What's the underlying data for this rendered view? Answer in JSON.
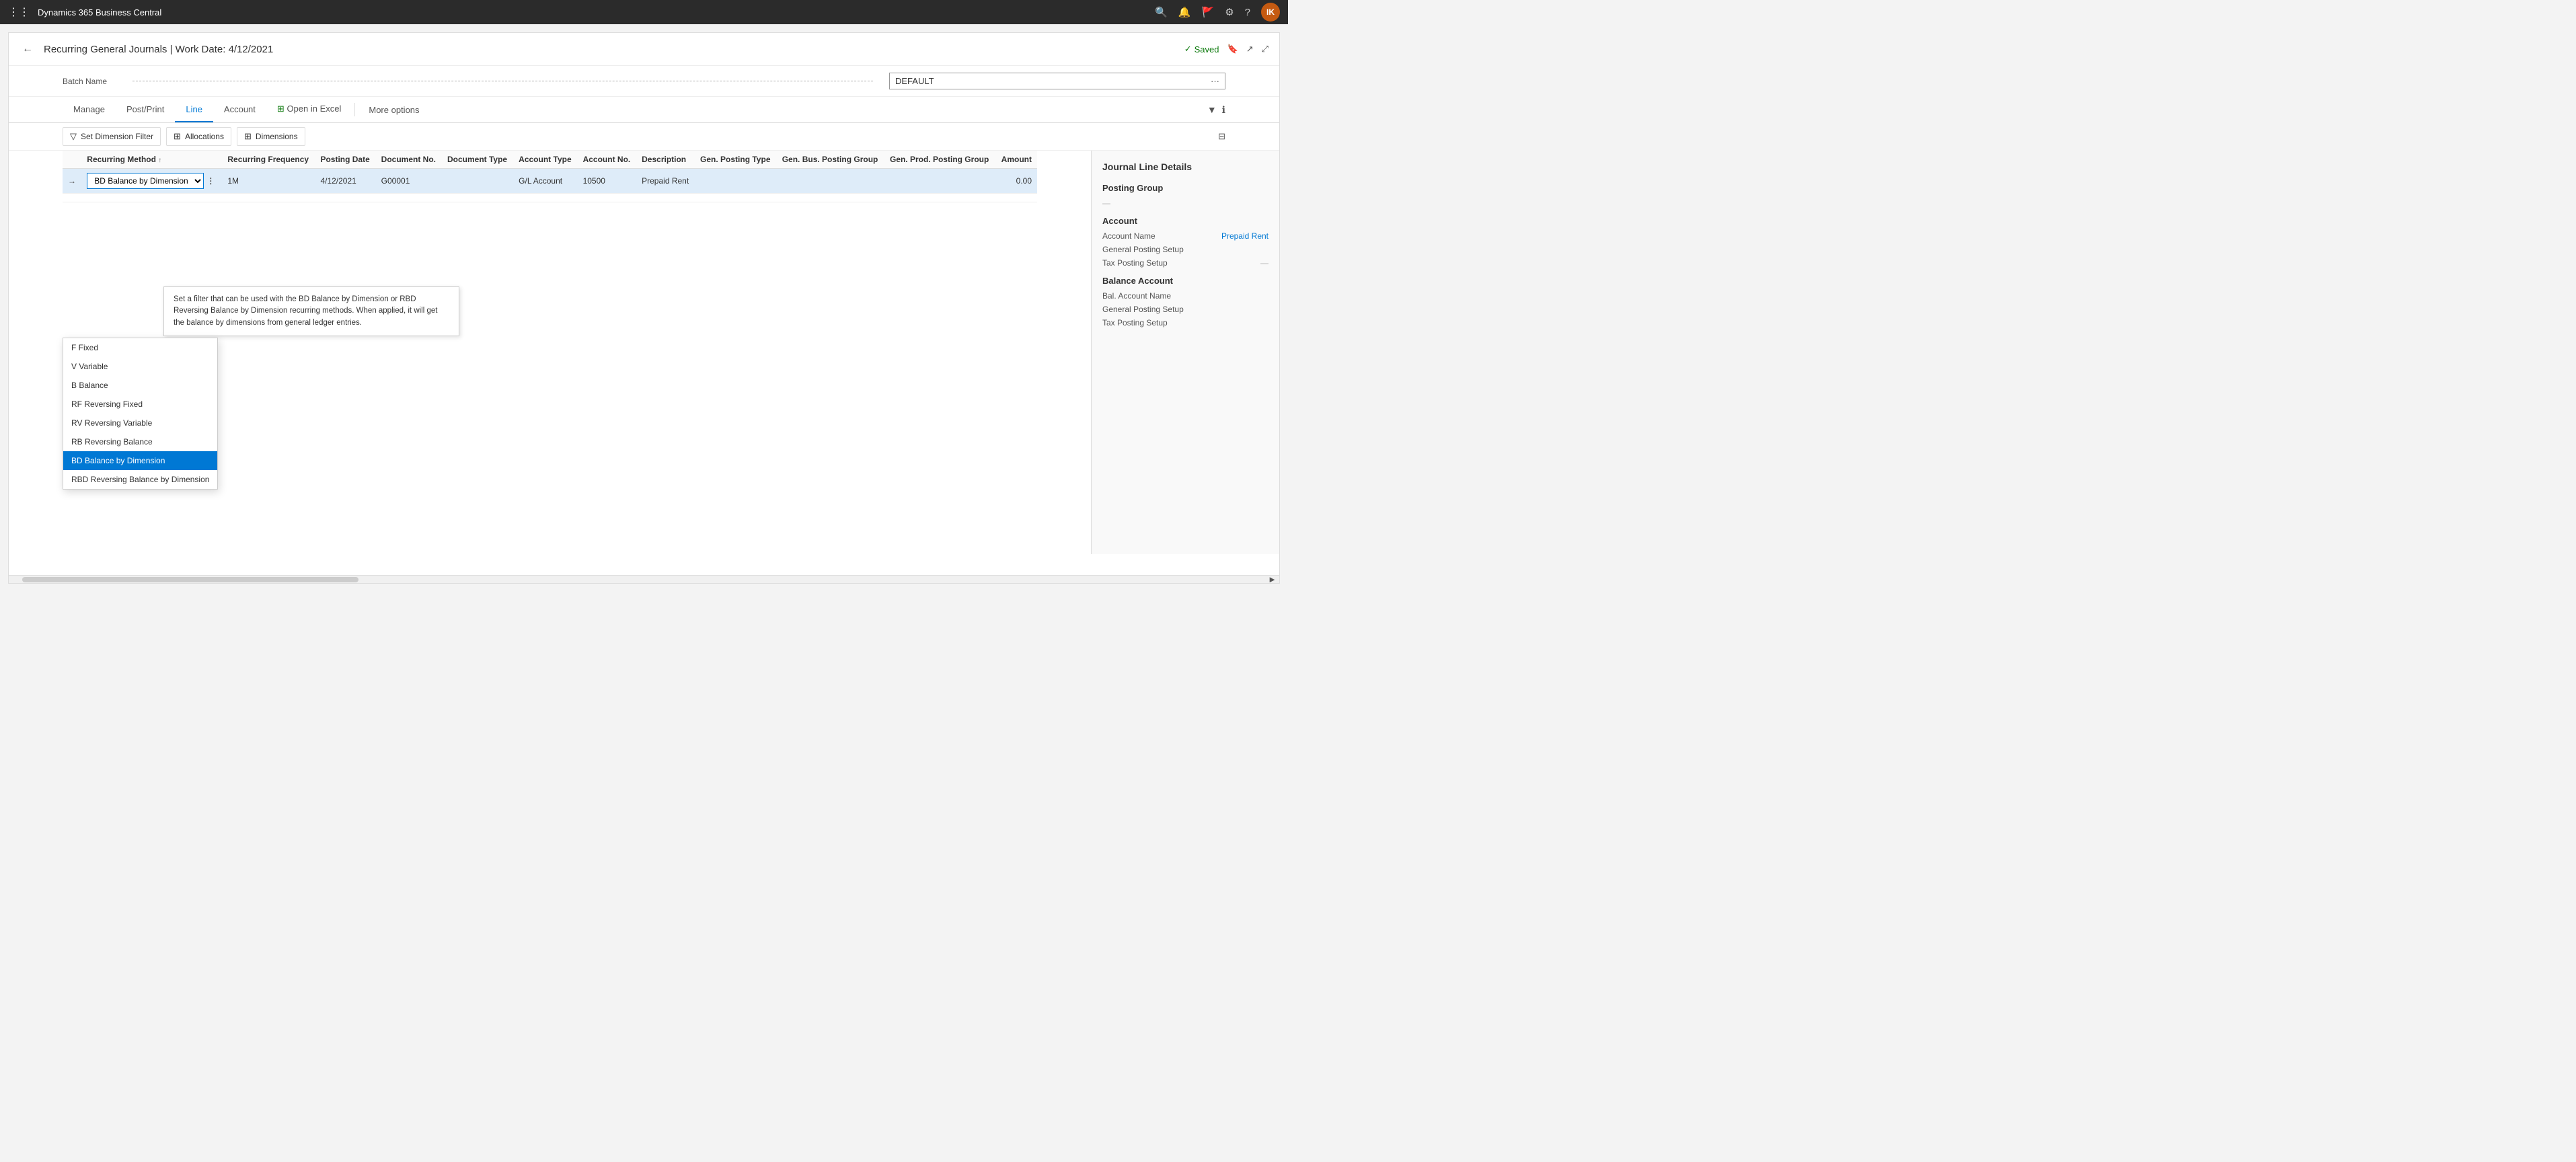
{
  "topNav": {
    "title": "Dynamics 365 Business Central",
    "icons": [
      "search",
      "bell",
      "flag",
      "gear",
      "help"
    ],
    "avatar": "IK"
  },
  "pageHeader": {
    "title": "Recurring General Journals | Work Date: 4/12/2021",
    "savedLabel": "Saved",
    "actions": [
      "bookmark",
      "open-external",
      "collapse"
    ]
  },
  "batchName": {
    "label": "Batch Name",
    "value": "DEFAULT",
    "ellipsisLabel": "···"
  },
  "tabs": {
    "items": [
      {
        "label": "Manage",
        "active": false
      },
      {
        "label": "Post/Print",
        "active": false
      },
      {
        "label": "Line",
        "active": true
      },
      {
        "label": "Account",
        "active": false
      },
      {
        "label": "Open in Excel",
        "active": false
      },
      {
        "label": "More options",
        "active": false
      }
    ]
  },
  "toolbar": {
    "setDimensionFilter": "Set Dimension Filter",
    "allocations": "Allocations",
    "dimensions": "Dimensions"
  },
  "tooltip": {
    "text": "Set a filter that can be used with the BD Balance by Dimension or RBD Reversing Balance by Dimension recurring methods. When applied, it will get the balance by dimensions from general ledger entries."
  },
  "table": {
    "columns": [
      {
        "label": "Recurring Method",
        "sortable": true
      },
      {
        "label": "Recurring Frequency"
      },
      {
        "label": "Posting Date"
      },
      {
        "label": "Document No."
      },
      {
        "label": "Document Type"
      },
      {
        "label": "Account Type"
      },
      {
        "label": "Account No."
      },
      {
        "label": "Description"
      },
      {
        "label": "Gen. Posting Type"
      },
      {
        "label": "Gen. Bus. Posting Group"
      },
      {
        "label": "Gen. Prod. Posting Group"
      },
      {
        "label": "Amount"
      }
    ],
    "rows": [
      {
        "recurringMethod": "BD Balance by Dimension",
        "recurringFrequency": "1M",
        "postingDate": "4/12/2021",
        "documentNo": "G00001",
        "documentType": "",
        "accountType": "G/L Account",
        "accountNo": "10500",
        "description": "Prepaid Rent",
        "genPostingType": "",
        "genBusPostingGroup": "",
        "genProdPostingGroup": "",
        "amount": "0.00"
      }
    ]
  },
  "dropdown": {
    "items": [
      {
        "label": "F Fixed",
        "highlighted": false
      },
      {
        "label": "V Variable",
        "highlighted": false
      },
      {
        "label": "B Balance",
        "highlighted": false
      },
      {
        "label": "RF Reversing Fixed",
        "highlighted": false
      },
      {
        "label": "RV Reversing Variable",
        "highlighted": false
      },
      {
        "label": "RB Reversing Balance",
        "highlighted": false
      },
      {
        "label": "BD Balance by Dimension",
        "highlighted": true
      },
      {
        "label": "RBD Reversing Balance by Dimension",
        "highlighted": false
      }
    ]
  },
  "rightPanel": {
    "title": "Journal Line Details",
    "sections": [
      {
        "title": "Posting Group",
        "fields": [
          {
            "label": "",
            "value": "—"
          }
        ]
      },
      {
        "title": "Account",
        "fields": [
          {
            "label": "Account Name",
            "value": "Prepaid Rent"
          },
          {
            "label": "General Posting Setup",
            "value": ""
          },
          {
            "label": "Tax Posting Setup",
            "value": "—"
          }
        ]
      },
      {
        "title": "Balance Account",
        "fields": [
          {
            "label": "Bal. Account Name",
            "value": ""
          },
          {
            "label": "General Posting Setup",
            "value": ""
          },
          {
            "label": "Tax Posting Setup",
            "value": ""
          }
        ]
      }
    ]
  }
}
